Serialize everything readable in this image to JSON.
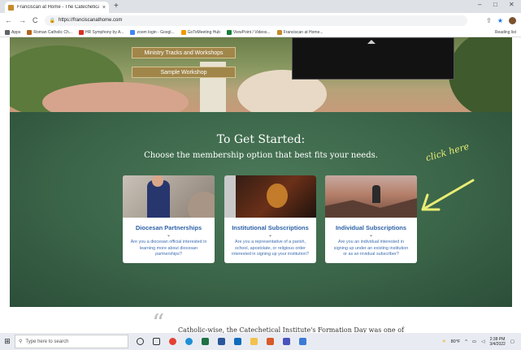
{
  "browser": {
    "tab_title": "Franciscan at Home - The Catechetical ...",
    "tab_close": "×",
    "new_tab": "+",
    "window_controls": [
      "–",
      "□",
      "✕"
    ],
    "nav": {
      "back": "←",
      "forward": "→",
      "reload": "C"
    },
    "url": "https://franciscanathome.com",
    "bookmarks": [
      {
        "label": "Apps",
        "color": "#5f6368"
      },
      {
        "label": "Roman Catholic Ch...",
        "color": "#b5651d"
      },
      {
        "label": "HR Symphony by A...",
        "color": "#d93025"
      },
      {
        "label": "zoom login - Googl...",
        "color": "#4285f4"
      },
      {
        "label": "GoToMeeting Hub",
        "color": "#f29900"
      },
      {
        "label": "ViewPoint / Videos...",
        "color": "#188038"
      },
      {
        "label": "Franciscan at Home...",
        "color": "#c58b2a"
      }
    ],
    "reading_list": "Reading list"
  },
  "hero": {
    "button_tracks": "Ministry Tracks and Workshops",
    "button_sample": "Sample Workshop"
  },
  "get_started": {
    "title": "To Get Started:",
    "subtitle": "Choose the membership option that best fits your needs."
  },
  "cards": [
    {
      "title": "Diocesan Partnerships",
      "chevron": "⌄",
      "description": "Are you a diocesan official interested in learning more about diocesan partnerships?"
    },
    {
      "title": "Institutional Subscriptions",
      "chevron": "⌄",
      "description": "Are you a representative of a parish, school, apostolate, or religious order interested in signing up your institution?"
    },
    {
      "title": "Individual Subscriptions",
      "chevron": "⌄",
      "description": "Are you an individual interested in signing up under an existing institution or as an invidual subscriber?"
    }
  ],
  "annotation": {
    "text": "click here",
    "color": "#e9ee74"
  },
  "quote": {
    "mark": "“",
    "text": "Catholic-wise, the Catechetical Institute's Formation Day was one of"
  },
  "taskbar": {
    "search_placeholder": "Type here to search",
    "weather": "80°F",
    "time": "2:38 PM",
    "date": "3/4/2022"
  },
  "colors": {
    "green_bg": "#3b6549",
    "card_title": "#2d62a6",
    "hero_button": "#a1864a"
  }
}
